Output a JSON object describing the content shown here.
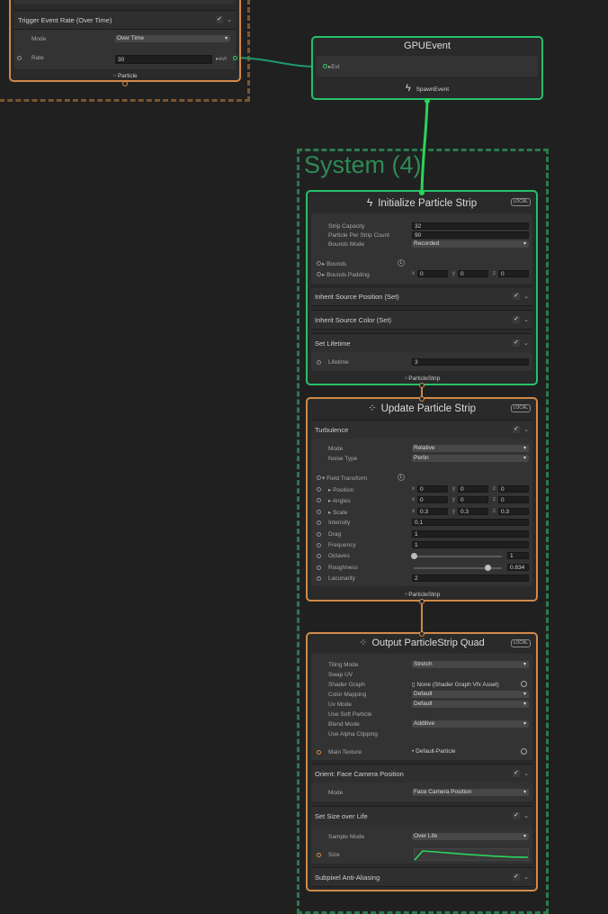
{
  "colors": {
    "background": "#202020",
    "green": "#27c06a",
    "orange": "#d08a4a",
    "node_bg": "#2a2a2a",
    "wire_green": "#2bd45a"
  },
  "spawner_node": {
    "block": {
      "label": "Trigger Event Rate (Over Time)",
      "enabled": "✓"
    },
    "mode_label": "Mode",
    "mode_value": "Over Time",
    "rate_label": "Rate",
    "rate_value": "30",
    "evt_label": "evt",
    "footer": "Particle"
  },
  "gpu_event": {
    "title": "GPUEvent",
    "port_label": "Evt",
    "footer": "SpawnEvent"
  },
  "system": {
    "title": "System (4)"
  },
  "init_node": {
    "title": "Initialize Particle Strip",
    "badge": "LOCAL",
    "strip_capacity_label": "Strip Capacity",
    "strip_capacity_value": "32",
    "particle_per_strip_label": "Particle Per Strip Count",
    "particle_per_strip_value": "90",
    "bounds_mode_label": "Bounds Mode",
    "bounds_mode_value": "Recorded",
    "bounds_label": "Bounds",
    "bounds_padding_label": "Bounds Padding",
    "bounds_padding": {
      "x": "0",
      "y": "0",
      "z": "0"
    },
    "blocks": [
      {
        "label": "Inherit Source Position (Set)",
        "enabled": "✓"
      },
      {
        "label": "Inherit Source Color (Set)",
        "enabled": "✓"
      },
      {
        "label": "Set Lifetime",
        "enabled": "✓"
      }
    ],
    "lifetime_label": "Lifetime",
    "lifetime_value": "3",
    "footer": "ParticleStrip"
  },
  "update_node": {
    "title": "Update Particle Strip",
    "badge": "LOCAL",
    "block": {
      "label": "Turbulence",
      "enabled": "✓"
    },
    "mode_label": "Mode",
    "mode_value": "Relative",
    "noise_label": "Noise Type",
    "noise_value": "Perlin",
    "field_transform_label": "Field Transform",
    "position_label": "Position",
    "position": {
      "x": "0",
      "y": "0",
      "z": "0"
    },
    "angles_label": "Angles",
    "angles": {
      "x": "0",
      "y": "0",
      "z": "0"
    },
    "scale_label": "Scale",
    "scale": {
      "x": "0.3",
      "y": "0.3",
      "z": "0.3"
    },
    "intensity_label": "Intensity",
    "intensity_value": "0.1",
    "drag_label": "Drag",
    "drag_value": "1",
    "frequency_label": "Frequency",
    "frequency_value": "1",
    "octaves_label": "Octaves",
    "octaves_value": "1",
    "octaves_fraction": 0.0,
    "roughness_label": "Roughness",
    "roughness_value": "0.834",
    "roughness_fraction": 0.834,
    "lacunarity_label": "Lacunarity",
    "lacunarity_value": "2",
    "footer": "ParticleStrip"
  },
  "output_node": {
    "title": "Output ParticleStrip Quad",
    "badge": "LOCAL",
    "tiling_label": "Tiling Mode",
    "tiling_value": "Stretch",
    "swap_uv_label": "Swap UV",
    "shader_graph_label": "Shader Graph",
    "shader_graph_value": "None (Shader Graph Vfx Asset)",
    "color_mapping_label": "Color Mapping",
    "color_mapping_value": "Default",
    "uv_mode_label": "Uv Mode",
    "uv_mode_value": "Default",
    "soft_particle_label": "Use Soft Particle",
    "blend_label": "Blend Mode",
    "blend_value": "Additive",
    "alpha_clip_label": "Use Alpha Clipping",
    "main_texture_label": "Main Texture",
    "main_texture_value": "Default-Particle",
    "orient_block": {
      "label": "Orient: Face Camera Position",
      "enabled": "✓"
    },
    "orient_mode_label": "Mode",
    "orient_mode_value": "Face Camera Position",
    "size_block": {
      "label": "Set Size over Life",
      "enabled": "✓"
    },
    "sample_mode_label": "Sample Mode",
    "sample_mode_value": "Over Life",
    "size_label": "Size",
    "aa_block": {
      "label": "Subpixel Anti-Aliasing",
      "enabled": "✓"
    }
  }
}
